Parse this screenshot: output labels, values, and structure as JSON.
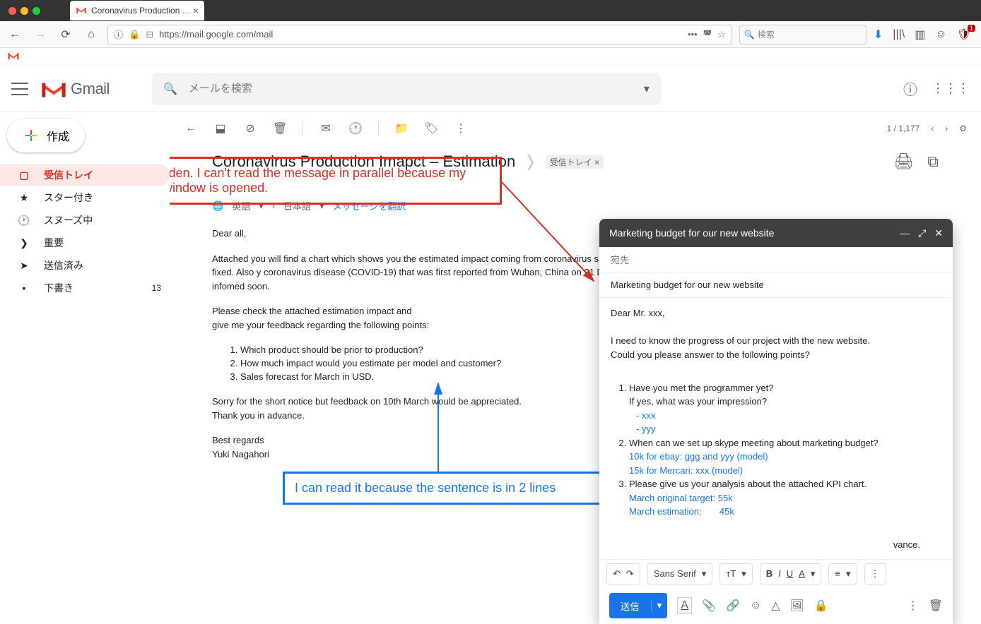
{
  "browser": {
    "tab_title": "Coronavirus Production Im…",
    "url": "https://mail.google.com/mail",
    "search_placeholder": "検索",
    "ublock_badge": "1"
  },
  "header": {
    "brand": "Gmail",
    "search_placeholder": "メールを検索"
  },
  "sidebar": {
    "compose_label": "作成",
    "items": [
      {
        "icon": "inbox",
        "label": "受信トレイ",
        "active": true
      },
      {
        "icon": "star",
        "label": "スター付き"
      },
      {
        "icon": "clock",
        "label": "スヌーズ中"
      },
      {
        "icon": "important",
        "label": "重要"
      },
      {
        "icon": "sent",
        "label": "送信済み"
      },
      {
        "icon": "draft",
        "label": "下書き",
        "count": "13"
      }
    ]
  },
  "toolbar": {
    "paging": "1 / 1,177"
  },
  "email": {
    "subject": "Coronavirus Production Imapct – Estimation",
    "label": "受信トレイ ×",
    "translate_from": "英語",
    "translate_to": "日本語",
    "translate_link": "メッセージを翻訳",
    "greeting": "Dear all,",
    "para1": "Attached you will find a chart which shows you the estimated impact coming from coronavirus sales. When the factory starts production will be updated as soon as the date is fixed. Also y coronavirus disease (COVID-19) that was first reported from Wuhan, China on 31 December protective equipment endangering health workers wordwide will be infomed soon.",
    "para2a": "Please check the attached estimation impact and",
    "para2b": "give me your feedback regarding the following points:",
    "q1": "Which product should be prior to production?",
    "q2": "How much impact would you estimate per model and customer?",
    "q3": "Sales forecast for March in USD.",
    "closing1": "Sorry for the short notice but feedback on 10th March would be appreciated.",
    "closing2": "Thank you in advance.",
    "signoff1": "Best regards",
    "signoff2": "Yuki Nagahori"
  },
  "annotations": {
    "red": "It's hidden. I can't read the message in parallel because my reply window is opened.",
    "blue": "I can read it because the sentence is in 2 lines"
  },
  "compose": {
    "title": "Marketing budget for our new website",
    "to_label": "宛先",
    "subject": "Marketing budget for our new website",
    "greeting": "Dear Mr. xxx,",
    "line1": "I need to know the progress of our project with the new website.",
    "line2": "Could you please answer to the following points?",
    "q1": "Have you met the programmer yet?",
    "q1b": "If yes, what was your impression?",
    "q1c": "- xxx",
    "q1d": "- yyy",
    "q2": "When can we set up skype meeting about marketing budget?",
    "q2b": "10k for ebay: ggg and yyy (model)",
    "q2c": "15k for Mercari: xxx (model)",
    "q3": "Please give us your analysis about the attached KPI chart.",
    "q3b": "March original target: 55k",
    "q3c": "March estimation:       45k",
    "closing_partial": "vance.",
    "font_label": "Sans Serif",
    "send_label": "送信"
  }
}
